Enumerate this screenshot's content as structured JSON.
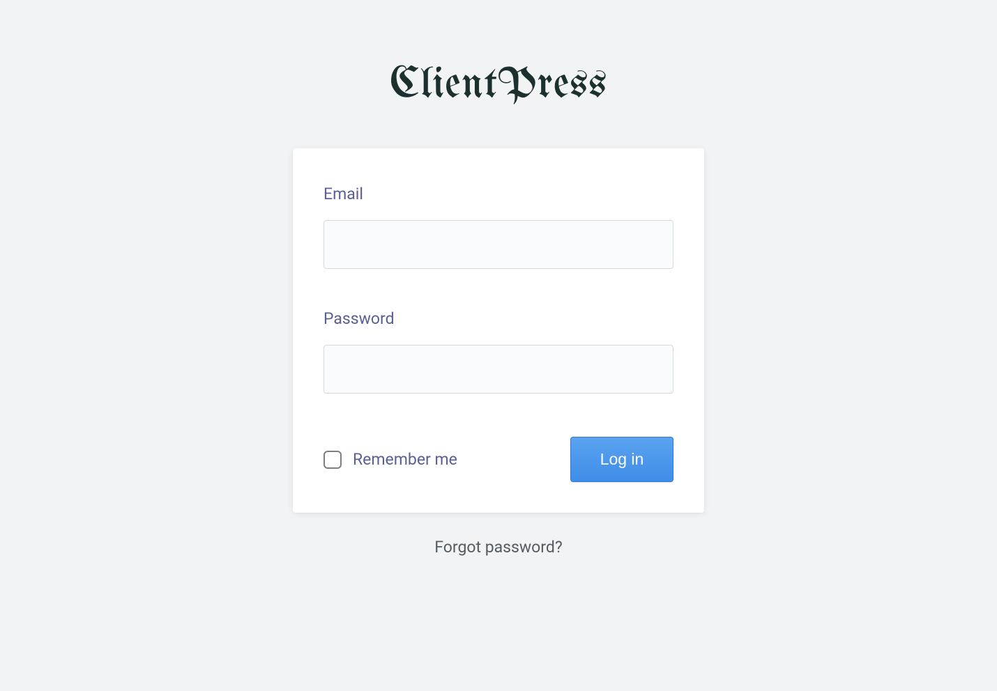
{
  "logo": {
    "text": "ClientPress"
  },
  "form": {
    "email_label": "Email",
    "email_value": "",
    "password_label": "Password",
    "password_value": "",
    "remember_label": "Remember me",
    "remember_checked": false,
    "submit_label": "Log in"
  },
  "links": {
    "forgot_password_label": "Forgot password?"
  }
}
